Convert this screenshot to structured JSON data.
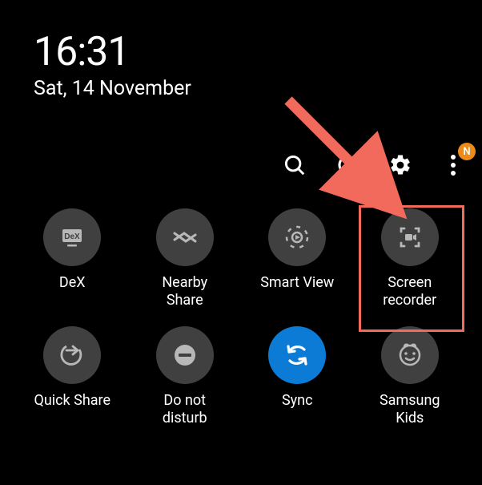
{
  "header": {
    "time": "16:31",
    "date": "Sat, 14 November"
  },
  "toolbar": {
    "badge": "N"
  },
  "tiles": [
    {
      "label": "DeX"
    },
    {
      "label": "Nearby\nShare"
    },
    {
      "label": "Smart View"
    },
    {
      "label": "Screen\nrecorder"
    },
    {
      "label": "Quick Share"
    },
    {
      "label": "Do not\ndisturb"
    },
    {
      "label": "Sync"
    },
    {
      "label": "Samsung\nKids"
    }
  ]
}
